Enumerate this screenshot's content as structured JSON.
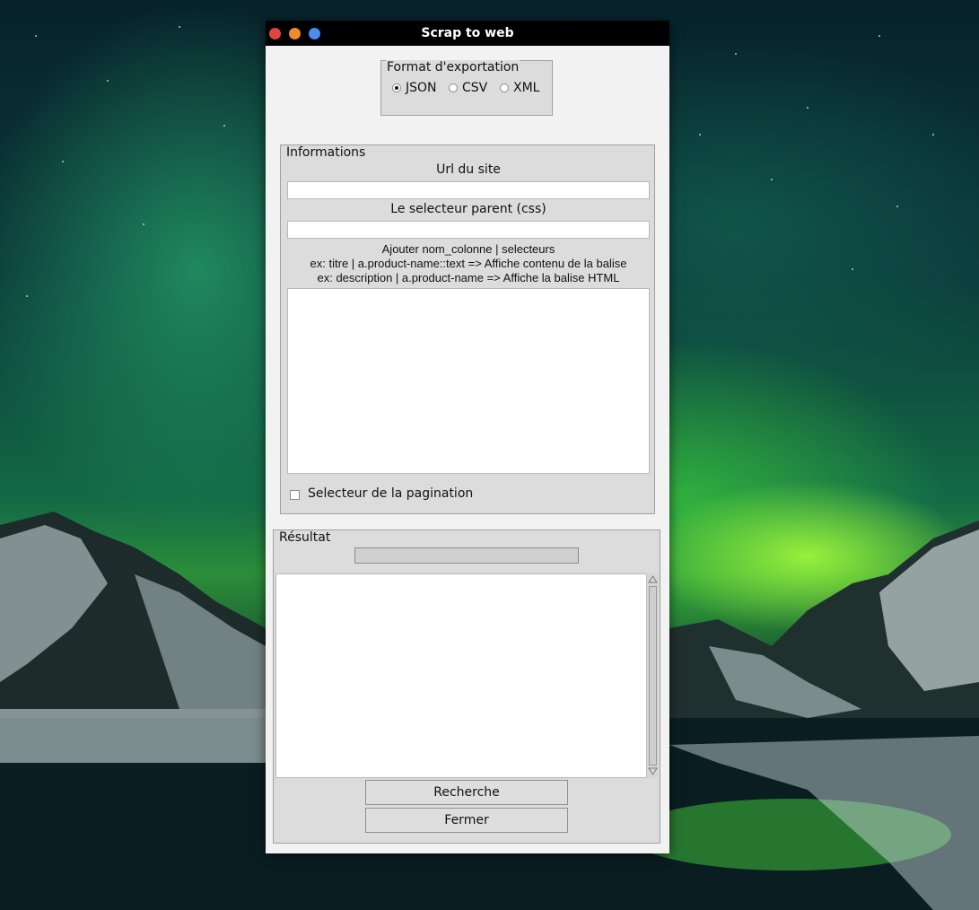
{
  "window": {
    "title": "Scrap to web",
    "controls": [
      "close-icon",
      "minimize-icon",
      "maximize-icon"
    ]
  },
  "export_format": {
    "legend": "Format d'exportation",
    "options": [
      {
        "label": "JSON",
        "selected": true
      },
      {
        "label": "CSV",
        "selected": false
      },
      {
        "label": "XML",
        "selected": false
      }
    ]
  },
  "informations": {
    "legend": "Informations",
    "url_label": "Url du site",
    "url_value": "",
    "parent_label": "Le selecteur parent (css)",
    "parent_value": "",
    "hint_line1": "Ajouter nom_colonne | selecteurs",
    "hint_line2": "ex: titre | a.product-name::text => Affiche contenu de la balise",
    "hint_line3": "ex: description | a.product-name => Affiche la balise HTML",
    "selectors_value": "",
    "pagination_label": "Selecteur de la pagination",
    "pagination_checked": false
  },
  "result": {
    "legend": "Résultat",
    "progress": 0,
    "output_value": "",
    "search_button": "Recherche",
    "close_button": "Fermer"
  },
  "colors": {
    "titlebar": "#000000",
    "close": "#e0443e",
    "minimize": "#f08a2b",
    "maximize": "#4a8cf0",
    "window_bg": "#f2f2f2",
    "frame_bg": "#dcdcdc"
  }
}
